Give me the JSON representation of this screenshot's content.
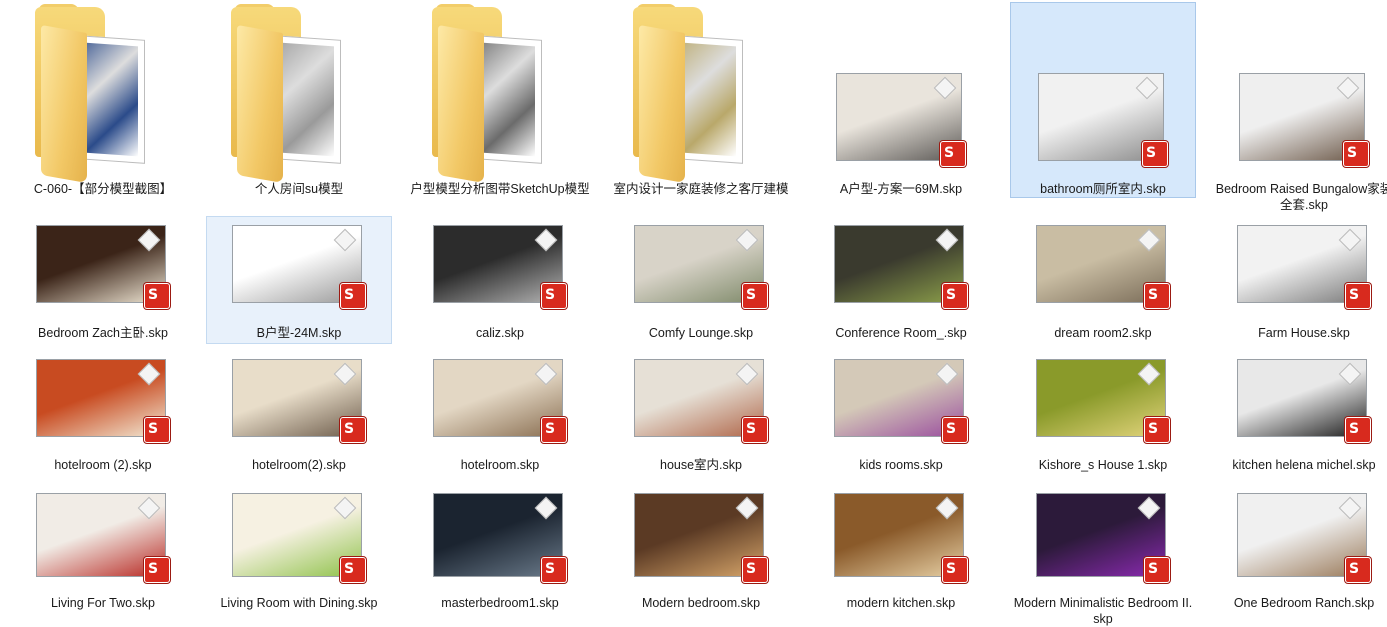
{
  "items": [
    {
      "label": "C-060-【部分模型截图】",
      "type": "folder",
      "paper": "#2b4b8a"
    },
    {
      "label": "个人房间su模型",
      "type": "folder",
      "paper": "#9a9a9a"
    },
    {
      "label": "户型模型分析图带SketchUp模型",
      "type": "folder",
      "paper": "#6b6b6b"
    },
    {
      "label": "室内设计一家庭装修之客厅建模",
      "type": "folder",
      "paper": "#b9a86a"
    },
    {
      "label": "A户型-方案一69M.skp",
      "type": "skp",
      "c1": "#e9e4dc",
      "c2": "#5d5a57"
    },
    {
      "label": "bathroom厕所室内.skp",
      "type": "skp",
      "c1": "#f1f1f1",
      "c2": "#8c8c8c",
      "selected": true
    },
    {
      "label": "Bedroom Raised Bungalow家装全套.skp",
      "type": "skp",
      "c1": "#efefef",
      "c2": "#6d5a4a"
    },
    {
      "label": "Bedroom Zach主卧.skp",
      "type": "skp",
      "c1": "#3b2418",
      "c2": "#efe6d4"
    },
    {
      "label": "B户型-24M.skp",
      "type": "skp",
      "c1": "#ffffff",
      "c2": "#9a9a9a",
      "hover": true
    },
    {
      "label": "caliz.skp",
      "type": "skp",
      "c1": "#2c2c2c",
      "c2": "#b4b4b4"
    },
    {
      "label": "Comfy Lounge.skp",
      "type": "skp",
      "c1": "#d8d3c8",
      "c2": "#7f8a6a"
    },
    {
      "label": "Conference Room_.skp",
      "type": "skp",
      "c1": "#3a3a2e",
      "c2": "#8c9f4a"
    },
    {
      "label": "dream room2.skp",
      "type": "skp",
      "c1": "#c9bda3",
      "c2": "#7b6d59"
    },
    {
      "label": "Farm House.skp",
      "type": "skp",
      "c1": "#f2f2f2",
      "c2": "#7b7b7b"
    },
    {
      "label": "hotelroom (2).skp",
      "type": "skp",
      "c1": "#c84b21",
      "c2": "#f2e9d5"
    },
    {
      "label": "hotelroom(2).skp",
      "type": "skp",
      "c1": "#e8ddc9",
      "c2": "#6e5d4c"
    },
    {
      "label": "hotelroom.skp",
      "type": "skp",
      "c1": "#e3d7c4",
      "c2": "#8a6f52"
    },
    {
      "label": "house室内.skp",
      "type": "skp",
      "c1": "#e6e0d6",
      "c2": "#b0674a"
    },
    {
      "label": "kids rooms.skp",
      "type": "skp",
      "c1": "#d4c9b8",
      "c2": "#9a4e9e"
    },
    {
      "label": "Kishore_s House 1.skp",
      "type": "skp",
      "c1": "#8a9a2a",
      "c2": "#e2d47c"
    },
    {
      "label": "kitchen helena michel.skp",
      "type": "skp",
      "c1": "#e8e8e8",
      "c2": "#1e1e1e"
    },
    {
      "label": "Living For Two.skp",
      "type": "skp",
      "c1": "#f1ece6",
      "c2": "#b82a24"
    },
    {
      "label": "Living Room with Dining.skp",
      "type": "skp",
      "c1": "#f6f1e2",
      "c2": "#8fc24a"
    },
    {
      "label": "masterbedroom1.skp",
      "type": "skp",
      "c1": "#1b2430",
      "c2": "#6a7a8a"
    },
    {
      "label": "Modern bedroom.skp",
      "type": "skp",
      "c1": "#5b3a24",
      "c2": "#d6a56a"
    },
    {
      "label": "modern kitchen.skp",
      "type": "skp",
      "c1": "#8a5a2a",
      "c2": "#e6cfa4"
    },
    {
      "label": "Modern Minimalistic Bedroom II.skp",
      "type": "skp",
      "c1": "#2c1a3a",
      "c2": "#8a2ab0"
    },
    {
      "label": "One Bedroom Ranch.skp",
      "type": "skp",
      "c1": "#f0f0f0",
      "c2": "#9a7a5a"
    }
  ]
}
